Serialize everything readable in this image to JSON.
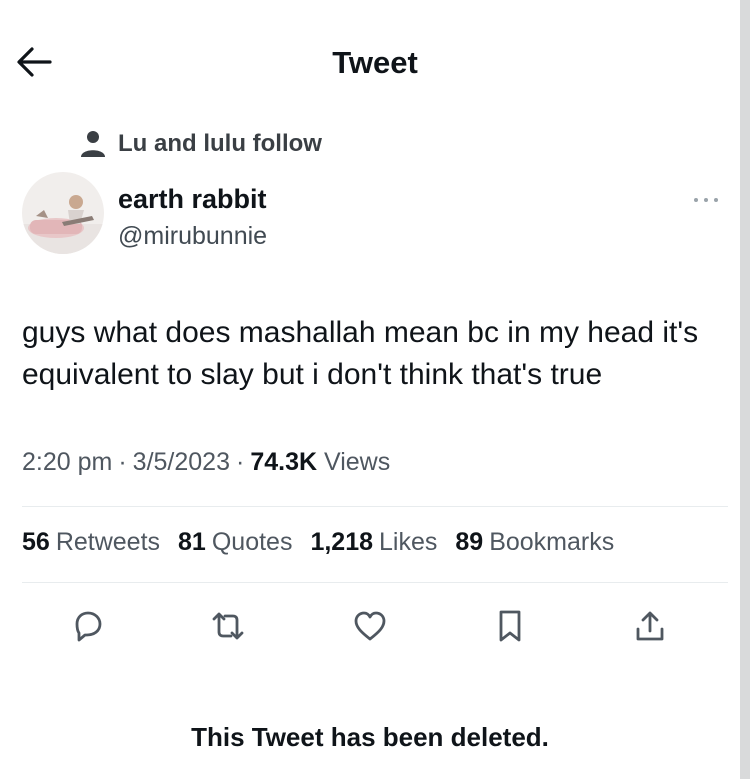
{
  "header": {
    "title": "Tweet",
    "back_icon": "arrow-left-icon"
  },
  "social_context": {
    "icon": "person-icon",
    "text": "Lu and lulu follow"
  },
  "author": {
    "display_name": "earth rabbit",
    "handle": "@mirubunnie",
    "avatar_icon": "avatar-image"
  },
  "tweet": {
    "text": "guys what does mashallah mean bc in my head it's equivalent to slay but i don't think that's true",
    "time": "2:20 pm",
    "date": "3/5/2023",
    "views_count": "74.3K",
    "views_label": "Views",
    "separator": "·"
  },
  "stats": {
    "retweets": {
      "count": "56",
      "label": "Retweets"
    },
    "quotes": {
      "count": "81",
      "label": "Quotes"
    },
    "likes": {
      "count": "1,218",
      "label": "Likes"
    },
    "bookmarks": {
      "count": "89",
      "label": "Bookmarks"
    }
  },
  "actions": [
    "reply-icon",
    "retweet-icon",
    "like-icon",
    "bookmark-icon",
    "share-icon"
  ],
  "footer": {
    "deleted_notice": "This Tweet has been deleted."
  },
  "colors": {
    "text_primary": "#0f1419",
    "text_secondary": "#4f5760",
    "divider": "#e8ecee",
    "icon": "#4f5760"
  }
}
